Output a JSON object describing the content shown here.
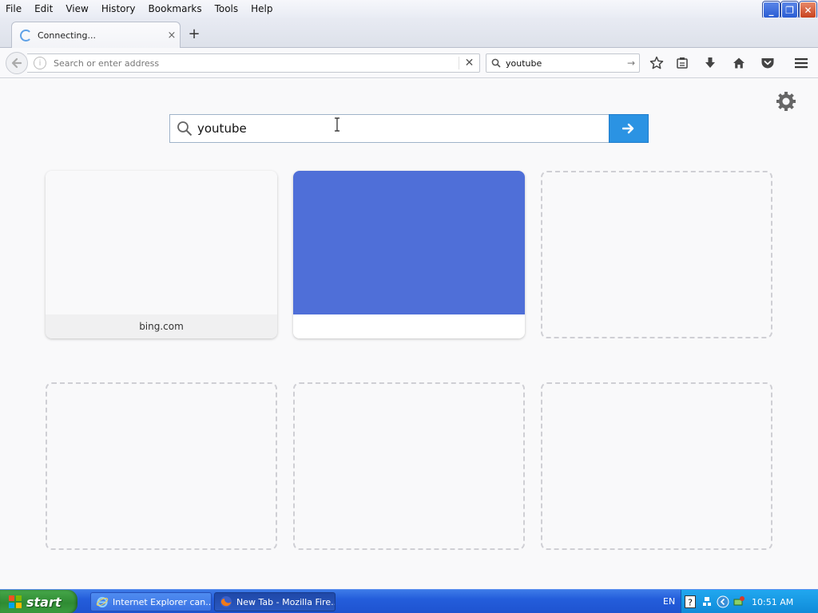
{
  "menubar": {
    "items": [
      "File",
      "Edit",
      "View",
      "History",
      "Bookmarks",
      "Tools",
      "Help"
    ]
  },
  "window_buttons": {
    "minimize": "_",
    "restore": "❐",
    "close": "✕"
  },
  "tab": {
    "title": "Connecting...",
    "close_glyph": "×",
    "new_tab_glyph": "+"
  },
  "navbar": {
    "url_value": "",
    "url_placeholder": "Search or enter address",
    "info_glyph": "i",
    "clear_glyph": "✕",
    "search_value": "youtube",
    "search_go_glyph": "→"
  },
  "newtab": {
    "search_value": "youtube",
    "tiles_row1": [
      {
        "kind": "filled",
        "caption": "bing.com",
        "thumb_color": "#f9f9fa",
        "caption_bg": "#f0f0f1"
      },
      {
        "kind": "filled",
        "caption": "",
        "thumb_color": "#4f6fd8",
        "caption_bg": "#ffffff"
      },
      {
        "kind": "empty"
      }
    ],
    "tiles_row2": [
      {
        "kind": "empty"
      },
      {
        "kind": "empty"
      },
      {
        "kind": "empty"
      }
    ]
  },
  "taskbar": {
    "start_label": "start",
    "tasks": [
      {
        "label": "Internet Explorer can...",
        "state": "inactive"
      },
      {
        "label": "New Tab - Mozilla Fire...",
        "state": "active"
      }
    ],
    "language": "EN",
    "clock": "10:51 AM"
  },
  "colors": {
    "accent_blue": "#2b93e3",
    "tile_blue": "#4f6fd8",
    "taskbar_blue": "#245ddb",
    "start_green": "#2f8b33"
  }
}
